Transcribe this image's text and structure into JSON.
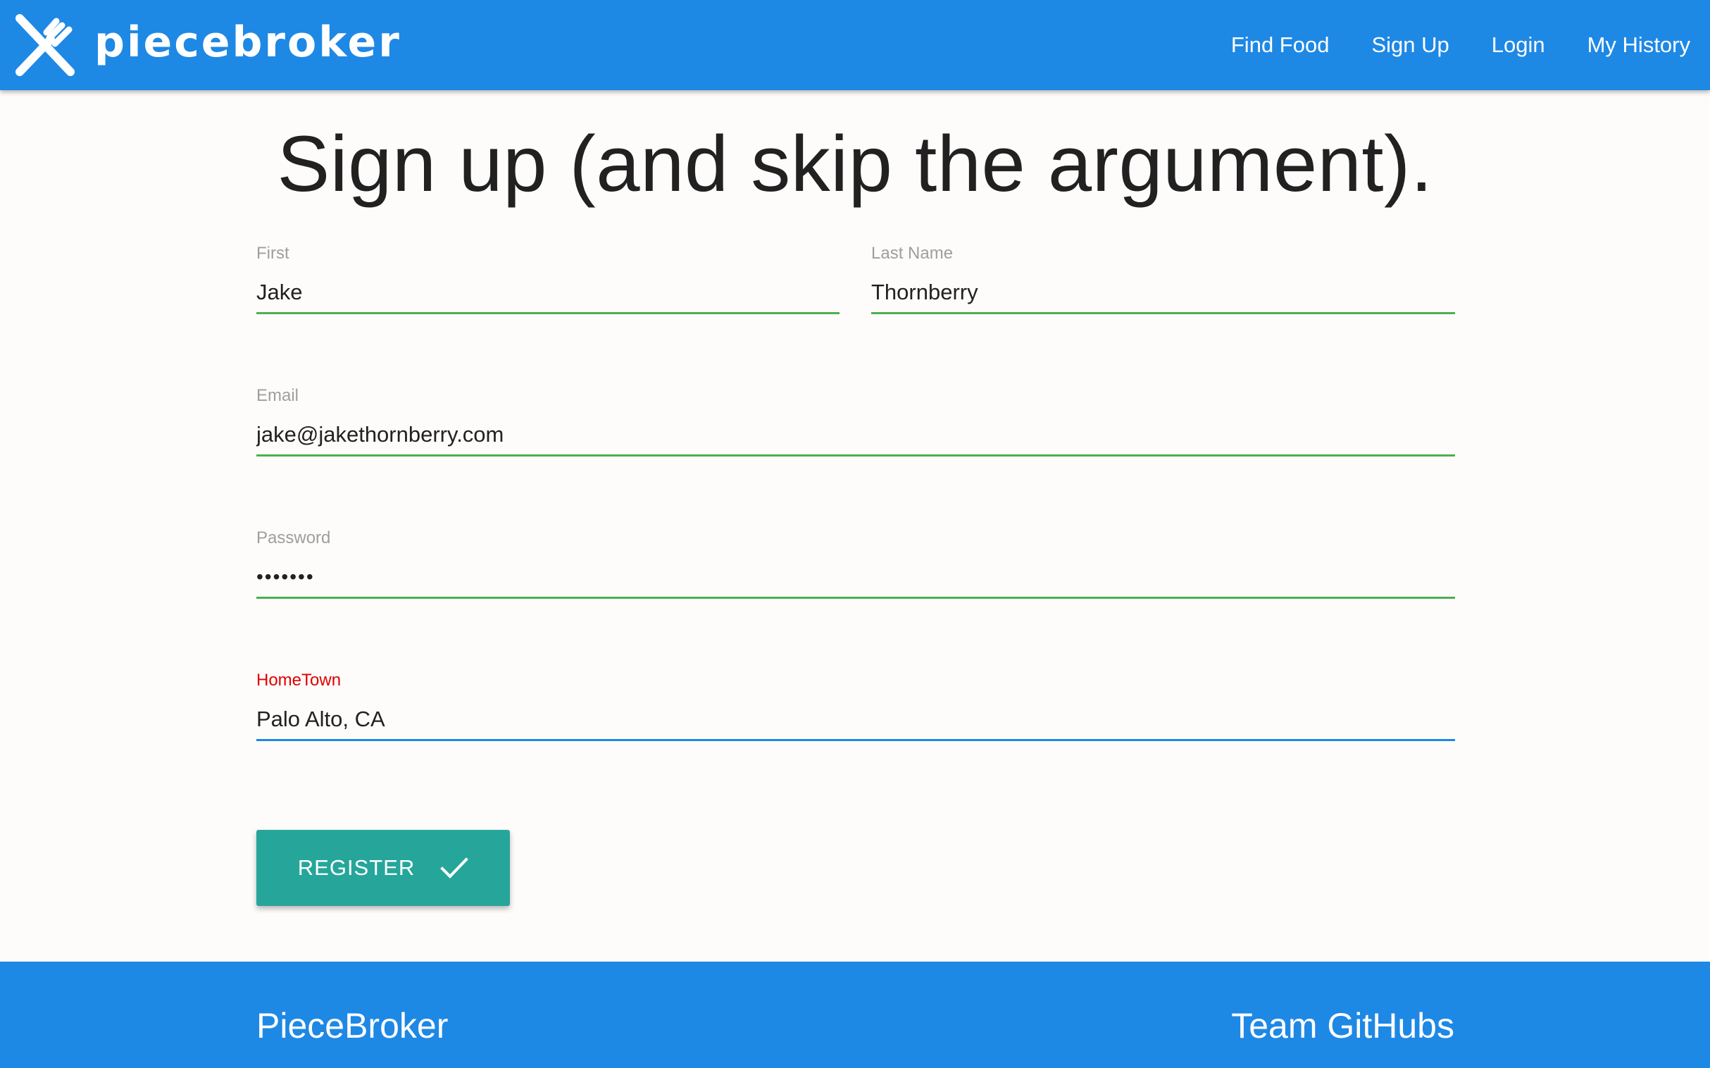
{
  "app": {
    "brand_name": "piecebroker",
    "logo_icon": "crossed-utensils-icon"
  },
  "nav": {
    "items": [
      {
        "label": "Find Food"
      },
      {
        "label": "Sign Up"
      },
      {
        "label": "Login"
      },
      {
        "label": "My History"
      }
    ]
  },
  "page": {
    "title": "Sign up (and skip the argument)."
  },
  "form": {
    "first": {
      "label": "First",
      "value": "Jake"
    },
    "last_name": {
      "label": "Last Name",
      "value": "Thornberry"
    },
    "email": {
      "label": "Email",
      "value": "jake@jakethornberry.com"
    },
    "password": {
      "label": "Password",
      "value": "•••••••"
    },
    "hometown": {
      "label": "HomeTown",
      "value": "Palo Alto, CA"
    },
    "register_label": "REGISTER",
    "register_icon": "check-icon"
  },
  "footer": {
    "brand": "PieceBroker",
    "links_title": "Team GitHubs"
  },
  "colors": {
    "primary": "#1e88e5",
    "valid_underline": "#4caf50",
    "active_label": "#e00000",
    "button": "#26a69a"
  }
}
